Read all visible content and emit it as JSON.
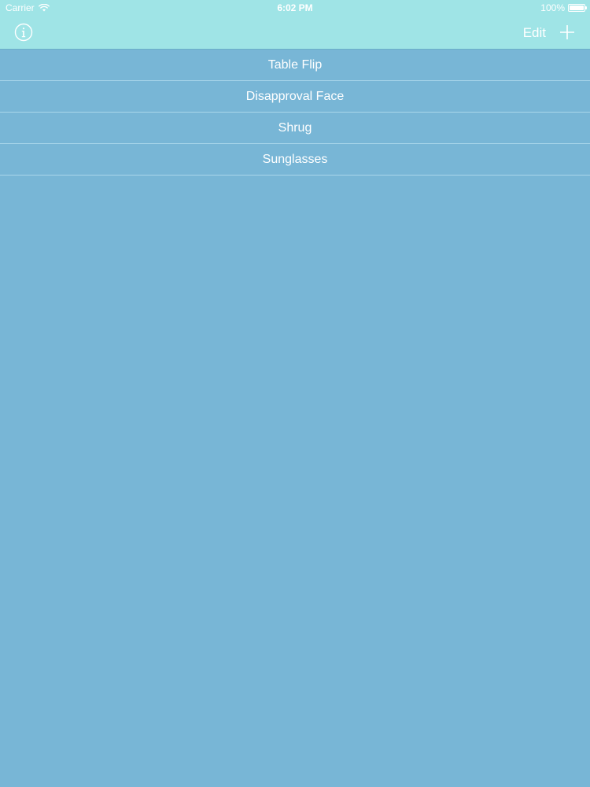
{
  "status_bar": {
    "carrier": "Carrier",
    "time": "6:02 PM",
    "battery": "100%"
  },
  "nav": {
    "info_icon": "info-circle-icon",
    "edit_label": "Edit",
    "add_icon": "plus-icon"
  },
  "list": {
    "items": [
      {
        "label": "Table Flip"
      },
      {
        "label": "Disapproval Face"
      },
      {
        "label": "Shrug"
      },
      {
        "label": "Sunglasses"
      }
    ]
  },
  "colors": {
    "background": "#78b6d6",
    "nav_background": "#9fe4e6",
    "text": "#ffffff",
    "separator": "#a9d6ea"
  }
}
